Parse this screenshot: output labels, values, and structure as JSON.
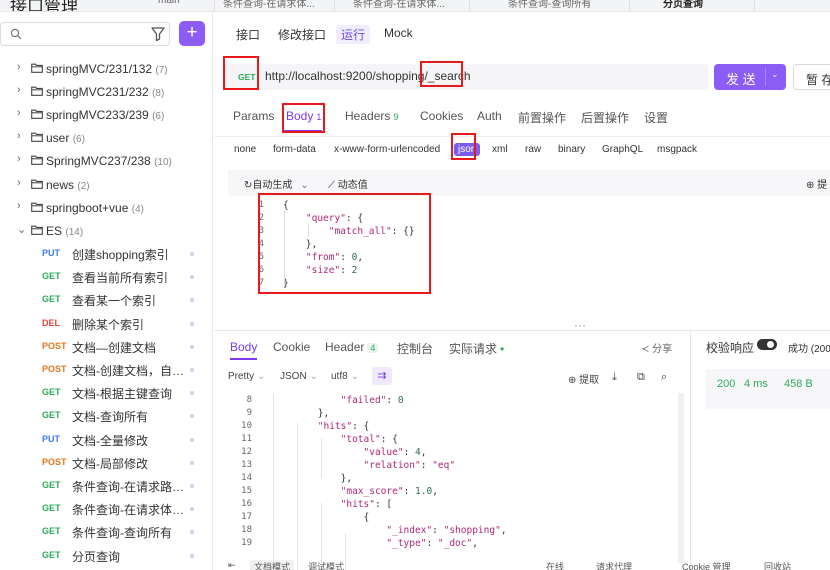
{
  "app": {
    "title": "接口管理"
  },
  "window_tabs": [
    "main",
    "条件查询-在请求体...",
    "条件查询-在请求体...",
    "条件查询-查询所有",
    "分页查询"
  ],
  "sidebar": {
    "search_placeholder": "",
    "add_label": "+",
    "folders": [
      {
        "name": "springMVC/231/132",
        "count": "(7)",
        "expanded": false
      },
      {
        "name": "springMVC231/232",
        "count": "(8)",
        "expanded": false
      },
      {
        "name": "springMVC233/239",
        "count": "(6)",
        "expanded": false
      },
      {
        "name": "user",
        "count": "(6)",
        "expanded": false
      },
      {
        "name": "SpringMVC237/238",
        "count": "(10)",
        "expanded": false
      },
      {
        "name": "news",
        "count": "(2)",
        "expanded": false
      },
      {
        "name": "springboot+vue",
        "count": "(4)",
        "expanded": false
      },
      {
        "name": "ES",
        "count": "(14)",
        "expanded": true
      }
    ],
    "apis": [
      {
        "method": "PUT",
        "name": "创建shopping索引"
      },
      {
        "method": "GET",
        "name": "查看当前所有索引"
      },
      {
        "method": "GET",
        "name": "查看某一个索引"
      },
      {
        "method": "DEL",
        "name": "删除某个索引"
      },
      {
        "method": "POST",
        "name": "文档—创建文档"
      },
      {
        "method": "POST",
        "name": "文档-创建文档，自定..."
      },
      {
        "method": "GET",
        "name": "文档-根据主键查询"
      },
      {
        "method": "GET",
        "name": "文档-查询所有"
      },
      {
        "method": "PUT",
        "name": "文档-全量修改"
      },
      {
        "method": "POST",
        "name": "文档-局部修改"
      },
      {
        "method": "GET",
        "name": "条件查询-在请求路径..."
      },
      {
        "method": "GET",
        "name": "条件查询-在请求体中..."
      },
      {
        "method": "GET",
        "name": "条件查询-查询所有"
      },
      {
        "method": "GET",
        "name": "分页查询"
      }
    ]
  },
  "colors": {
    "accent": "#8b5cf6",
    "get": "#2eaa5a",
    "post": "#e8751a",
    "put": "#3a7cf0",
    "del": "#e0463b",
    "annotation": "#e8191b"
  },
  "main": {
    "top_tabs": [
      "接口",
      "修改接口",
      "运行",
      "Mock"
    ],
    "url": {
      "method": "GET",
      "prefix": "http://localhost:9200/shopping/",
      "suffix": "_search"
    },
    "send_label": "发 送",
    "save_label": "暂 存",
    "request_tabs": [
      {
        "label": "Params",
        "count": ""
      },
      {
        "label": "Body",
        "count": "1"
      },
      {
        "label": "Headers",
        "count": "9"
      },
      {
        "label": "Cookies",
        "count": ""
      },
      {
        "label": "Auth",
        "count": ""
      },
      {
        "label": "前置操作",
        "count": ""
      },
      {
        "label": "后置操作",
        "count": ""
      },
      {
        "label": "设置",
        "count": ""
      }
    ],
    "body_types": [
      "none",
      "form-data",
      "x-www-form-urlencoded",
      "json",
      "xml",
      "raw",
      "binary",
      "GraphQL",
      "msgpack"
    ],
    "editor_tools": {
      "auto_generate": "自动生成",
      "dynamic_value": "动态值",
      "extract": "提"
    },
    "request_body_lines": [
      {
        "n": "1",
        "t": "{"
      },
      {
        "n": "2",
        "t": "    \"query\": {"
      },
      {
        "n": "3",
        "t": "        \"match_all\": {}"
      },
      {
        "n": "4",
        "t": "    },"
      },
      {
        "n": "5",
        "t": "    \"from\": 0,"
      },
      {
        "n": "6",
        "t": "    \"size\": 2"
      },
      {
        "n": "7",
        "t": "}"
      }
    ]
  },
  "response": {
    "tabs": [
      {
        "label": "Body",
        "count": ""
      },
      {
        "label": "Cookie",
        "count": ""
      },
      {
        "label": "Header",
        "count": "4"
      },
      {
        "label": "控制台",
        "count": ""
      },
      {
        "label": "实际请求",
        "count": ""
      }
    ],
    "share_label": "分享",
    "format": {
      "pretty": "Pretty",
      "type": "JSON",
      "encoding": "utf8"
    },
    "extract_label": "提取",
    "validate_label": "校验响应",
    "success_label": "成功 (200",
    "status": {
      "code": "200",
      "time": "4 ms",
      "size": "458 B"
    },
    "lines": [
      {
        "n": "8",
        "t": "            \"failed\": 0"
      },
      {
        "n": "9",
        "t": "        },"
      },
      {
        "n": "10",
        "t": "        \"hits\": {"
      },
      {
        "n": "11",
        "t": "            \"total\": {"
      },
      {
        "n": "12",
        "t": "                \"value\": 4,"
      },
      {
        "n": "13",
        "t": "                \"relation\": \"eq\""
      },
      {
        "n": "14",
        "t": "            },"
      },
      {
        "n": "15",
        "t": "            \"max_score\": 1.0,"
      },
      {
        "n": "16",
        "t": "            \"hits\": ["
      },
      {
        "n": "17",
        "t": "                {"
      },
      {
        "n": "18",
        "t": "                    \"_index\": \"shopping\","
      },
      {
        "n": "19",
        "t": "                    \"_type\": \"_doc\","
      }
    ]
  },
  "bottom_bar": [
    "文档模式",
    "调试模式",
    "在线",
    "请求代理",
    "Cookie 管理",
    "回收站"
  ]
}
